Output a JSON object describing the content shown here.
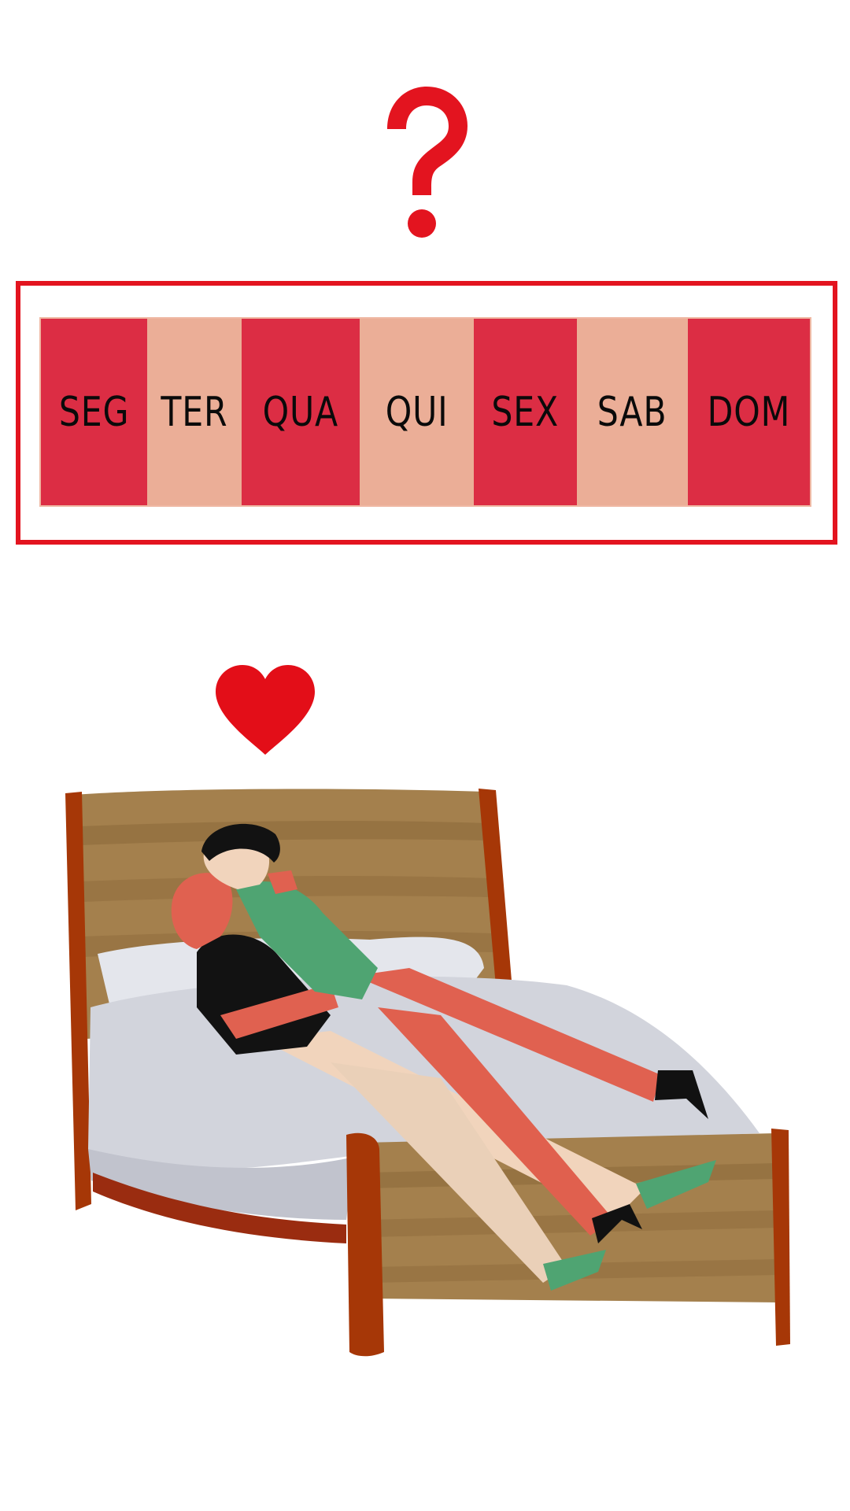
{
  "colors": {
    "accent_red": "#e3141f",
    "day_dark": "#dc2d44",
    "day_light": "#ebae97",
    "text": "#0a0a0a",
    "heart": "#e30e18",
    "bed_wood": "#a4804d",
    "bed_post": "#a63707",
    "sheet": "#d2d4dc",
    "shirt_green": "#4fa472",
    "skin_red": "#e06150"
  },
  "question_icon": "question-mark-icon",
  "heart_icon": "heart-icon",
  "week": {
    "days": [
      {
        "label": "SEG",
        "shade": "dark"
      },
      {
        "label": "TER",
        "shade": "light"
      },
      {
        "label": "QUA",
        "shade": "dark"
      },
      {
        "label": "QUI",
        "shade": "light"
      },
      {
        "label": "SEX",
        "shade": "dark"
      },
      {
        "label": "SAB",
        "shade": "light"
      },
      {
        "label": "DOM",
        "shade": "dark"
      }
    ]
  },
  "illustration": "couple-kissing-on-bed"
}
